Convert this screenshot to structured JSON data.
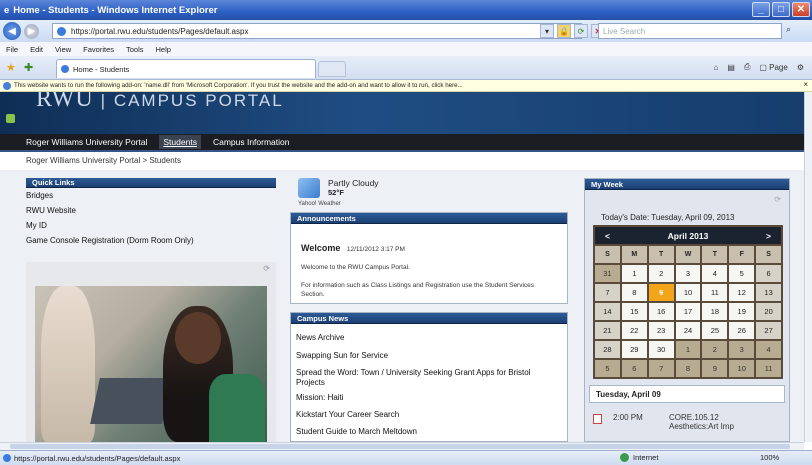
{
  "window": {
    "title": "Home - Students - Windows Internet Explorer"
  },
  "address": {
    "url": "https://portal.rwu.edu/students/Pages/default.aspx",
    "search_placeholder": "Live Search"
  },
  "menu": [
    "File",
    "Edit",
    "View",
    "Favorites",
    "Tools",
    "Help"
  ],
  "tab": {
    "label": "Home - Students"
  },
  "commandbar": {
    "page_label": "Page",
    "tools_label": "▾"
  },
  "infobar": {
    "text": "This website wants to run the following add-on: 'name.dll' from 'Microsoft Corporation'. If you trust the website and the add-on and want to allow it to run, click here..."
  },
  "portal": {
    "logo": "RWU",
    "logo_sub": "CAMPUS PORTAL",
    "nav": [
      "Roger Williams University Portal",
      "Students",
      "Campus Information"
    ],
    "breadcrumb": "Roger Williams University Portal >  Students"
  },
  "quick_links": {
    "title": "Quick Links",
    "links": [
      "Bridges",
      "RWU Website",
      "My ID",
      "Game Console Registration (Dorm Room Only)"
    ]
  },
  "weather": {
    "condition": "Partly Cloudy",
    "temp": "52°F",
    "source": "Yahoo! Weather"
  },
  "announcements": {
    "title": "Announcements",
    "heading": "Welcome",
    "date": "12/11/2012 3:17 PM",
    "p1": "Welcome to the RWU Campus Portal.",
    "p2": "For information such as Class Listings and Registration use the Student Services Section."
  },
  "campus_news": {
    "title": "Campus News",
    "items": [
      "News Archive",
      "Swapping Sun for Service",
      "Spread the Word: Town / University Seeking Grant Apps for Bristol Projects",
      "Mission: Haiti",
      "Kickstart Your Career Search",
      "Student Guide to March Meltdown"
    ]
  },
  "my_week": {
    "title": "My Week",
    "today": "Today's Date:  Tuesday, April 09, 2013",
    "month": "April 2013",
    "prev": "<",
    "next": ">",
    "days": [
      "S",
      "M",
      "T",
      "W",
      "T",
      "F",
      "S"
    ],
    "weeks": [
      [
        "31",
        "1",
        "2",
        "3",
        "4",
        "5",
        "6"
      ],
      [
        "7",
        "8",
        "9",
        "10",
        "11",
        "12",
        "13"
      ],
      [
        "14",
        "15",
        "16",
        "17",
        "18",
        "19",
        "20"
      ],
      [
        "21",
        "22",
        "23",
        "24",
        "25",
        "26",
        "27"
      ],
      [
        "28",
        "29",
        "30",
        "1",
        "2",
        "3",
        "4"
      ],
      [
        "5",
        "6",
        "7",
        "8",
        "9",
        "10",
        "11"
      ]
    ],
    "selected": "9",
    "day_heading": "Tuesday, April 09",
    "event": {
      "time": "2:00 PM",
      "course": "CORE.105.12",
      "name": "Aesthetics:Art Imp"
    }
  },
  "status": {
    "url": "https://portal.rwu.edu/students/Pages/default.aspx",
    "zone": "Internet",
    "zoom": "100%"
  }
}
